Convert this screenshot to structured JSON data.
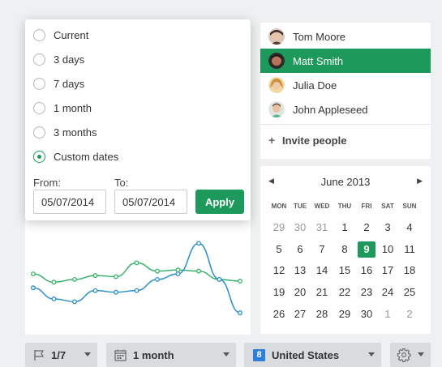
{
  "range_popup": {
    "options": [
      {
        "label": "Current",
        "checked": false
      },
      {
        "label": "3 days",
        "checked": false
      },
      {
        "label": "7 days",
        "checked": false
      },
      {
        "label": "1 month",
        "checked": false
      },
      {
        "label": "3 months",
        "checked": false
      },
      {
        "label": "Custom dates",
        "checked": true
      }
    ],
    "from_label": "From:",
    "to_label": "To:",
    "from_value": "05/07/2014",
    "to_value": "05/07/2014",
    "apply_label": "Apply"
  },
  "chart_data": {
    "type": "line",
    "series": [
      {
        "color": "#3ab26a",
        "values": [
          60,
          45,
          50,
          57,
          55,
          80,
          65,
          67,
          65,
          50,
          47
        ]
      },
      {
        "color": "#2a8fca",
        "values": [
          35,
          15,
          10,
          30,
          27,
          30,
          50,
          60,
          115,
          50,
          -10
        ]
      }
    ],
    "ylim": [
      -20,
      130
    ],
    "grid": false,
    "legend": "none"
  },
  "people": {
    "items": [
      {
        "name": "Tom Moore",
        "selected": false,
        "avatar_icon": "avatar-tom-moore-icon"
      },
      {
        "name": "Matt Smith",
        "selected": true,
        "avatar_icon": "avatar-matt-smith-icon"
      },
      {
        "name": "Julia Doe",
        "selected": false,
        "avatar_icon": "avatar-julia-doe-icon"
      },
      {
        "name": "John Appleseed",
        "selected": false,
        "avatar_icon": "avatar-john-appleseed-icon"
      }
    ],
    "invite_icon": "plus-icon",
    "invite_label": "Invite people"
  },
  "calendar": {
    "prev_icon": "◀",
    "next_icon": "▶",
    "month": "June 2013",
    "weekdays": [
      "MON",
      "TUE",
      "WED",
      "THU",
      "FRI",
      "SAT",
      "SUN"
    ],
    "weeks": [
      [
        "29",
        "30",
        "31",
        "1",
        "2",
        "3",
        "4"
      ],
      [
        "5",
        "6",
        "7",
        "8",
        "9",
        "10",
        "11"
      ],
      [
        "12",
        "13",
        "14",
        "15",
        "16",
        "17",
        "18"
      ],
      [
        "19",
        "20",
        "21",
        "22",
        "23",
        "24",
        "25"
      ],
      [
        "26",
        "27",
        "28",
        "29",
        "30",
        "1",
        "2"
      ]
    ],
    "today": "9"
  },
  "toolbar": {
    "flag_icon": "flag-icon",
    "flag_label": "1/7",
    "period_icon": "calendar-icon",
    "period_label": "1 month",
    "country_badge": "8",
    "country_label": "United States",
    "settings_icon": "gear-icon"
  },
  "colors": {
    "accent": "#1d9a5b",
    "background": "#eef0f2",
    "toolbar": "#d9dcdf"
  }
}
